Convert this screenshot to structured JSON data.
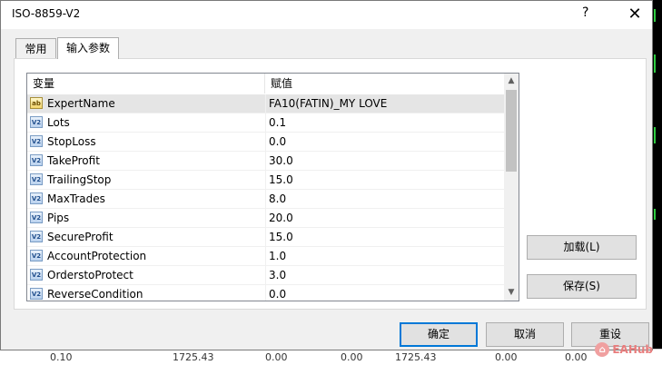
{
  "window": {
    "title": "ISO-8859-V2",
    "help_label": "?",
    "close_label": "✕"
  },
  "tabs": [
    {
      "label": "常用"
    },
    {
      "label": "输入参数"
    }
  ],
  "table": {
    "headers": {
      "variable": "变量",
      "value": "赋值"
    },
    "rows": [
      {
        "icon": "ab",
        "name": "ExpertName",
        "value": "FA10(FATIN)_MY LOVE"
      },
      {
        "icon": "V2",
        "name": "Lots",
        "value": "0.1"
      },
      {
        "icon": "V2",
        "name": "StopLoss",
        "value": "0.0"
      },
      {
        "icon": "V2",
        "name": "TakeProfit",
        "value": "30.0"
      },
      {
        "icon": "V2",
        "name": "TrailingStop",
        "value": "15.0"
      },
      {
        "icon": "V2",
        "name": "MaxTrades",
        "value": "8.0"
      },
      {
        "icon": "V2",
        "name": "Pips",
        "value": "20.0"
      },
      {
        "icon": "V2",
        "name": "SecureProfit",
        "value": "15.0"
      },
      {
        "icon": "V2",
        "name": "AccountProtection",
        "value": "1.0"
      },
      {
        "icon": "V2",
        "name": "OrderstoProtect",
        "value": "3.0"
      },
      {
        "icon": "V2",
        "name": "ReverseCondition",
        "value": "0.0"
      }
    ]
  },
  "side_buttons": {
    "load": "加载(L)",
    "save": "保存(S)"
  },
  "footer_buttons": {
    "ok": "确定",
    "cancel": "取消",
    "reset": "重设"
  },
  "watermark": {
    "icon": "⌂",
    "text": "EAHub"
  },
  "background_bottom": [
    "0.10",
    "1725.43",
    "0.00",
    "0.00",
    "1725.43",
    "0.00",
    "0.00"
  ]
}
